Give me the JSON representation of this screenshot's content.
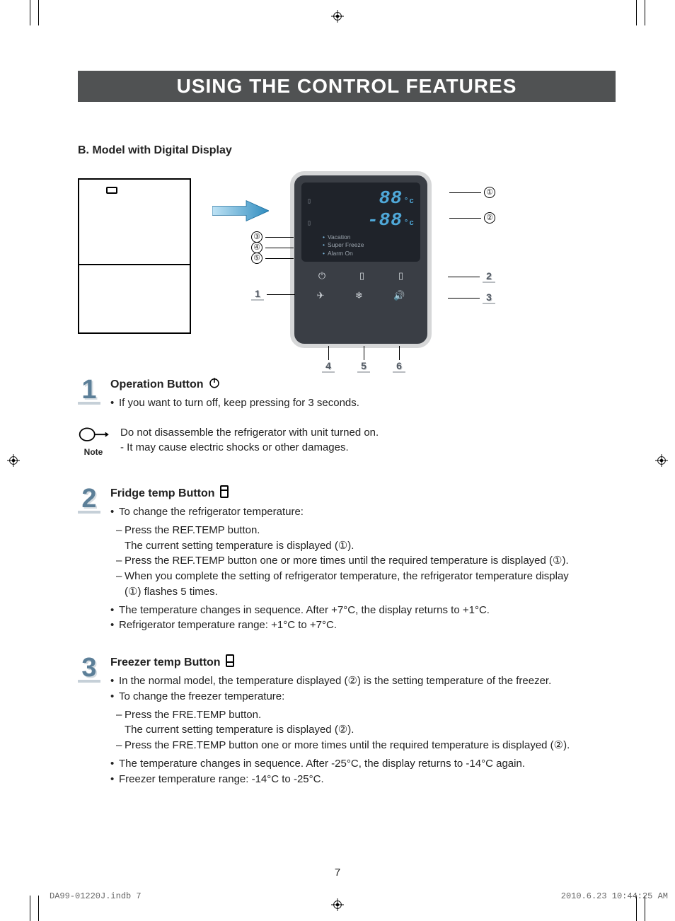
{
  "header": {
    "title": "USING THE CONTROL FEATURES"
  },
  "subhead": "B. Model with Digital Display",
  "panel": {
    "fridge_temp": "88",
    "freezer_temp": "-88",
    "unit_suffix": "°c",
    "status": [
      "Vacation",
      "Super Freeze",
      "Alarm On"
    ]
  },
  "callouts_circ": {
    "c1": "①",
    "c2": "②",
    "c3": "③",
    "c4": "④",
    "c5": "⑤"
  },
  "callouts_box": {
    "b1": "1",
    "b2": "2",
    "b3": "3",
    "b4": "4",
    "b5": "5",
    "b6": "6"
  },
  "section1": {
    "num": "1",
    "title": "Operation Button",
    "bullet": "If you want to turn off, keep pressing for 3 seconds."
  },
  "note": {
    "label": "Note",
    "line1": "Do not disassemble the refrigerator with unit turned on.",
    "line2": "- It may cause electric shocks or other damages."
  },
  "section2": {
    "num": "2",
    "title": "Fridge temp Button",
    "b1": "To change the refrigerator temperature:",
    "s1a": "Press the REF.TEMP button.",
    "s1b": "The current setting temperature is displayed (①).",
    "s2": "Press the REF.TEMP button one or more times until the required temperature is displayed (①).",
    "s3a": "When you complete the setting of refrigerator temperature, the refrigerator temperature display",
    "s3b": "(①) flashes 5 times.",
    "b2": "The temperature changes in sequence. After +7°C, the display returns to +1°C.",
    "b3": "Refrigerator temperature range: +1°C to +7°C."
  },
  "section3": {
    "num": "3",
    "title": "Freezer temp Button",
    "b1": "In the normal model, the temperature displayed (②) is the setting temperature of the freezer.",
    "b2": "To change the freezer temperature:",
    "s1a": "Press the FRE.TEMP button.",
    "s1b": "The current setting temperature is displayed (②).",
    "s2": "Press the FRE.TEMP button one or more times until the required temperature is displayed (②).",
    "b3": "The temperature changes in sequence. After -25°C, the display returns to -14°C again.",
    "b4": "Freezer temperature range: -14°C to -25°C."
  },
  "page_number": "7",
  "footer": {
    "file": "DA99-01220J.indb   7",
    "stamp": "2010.6.23   10:44:25 AM"
  }
}
